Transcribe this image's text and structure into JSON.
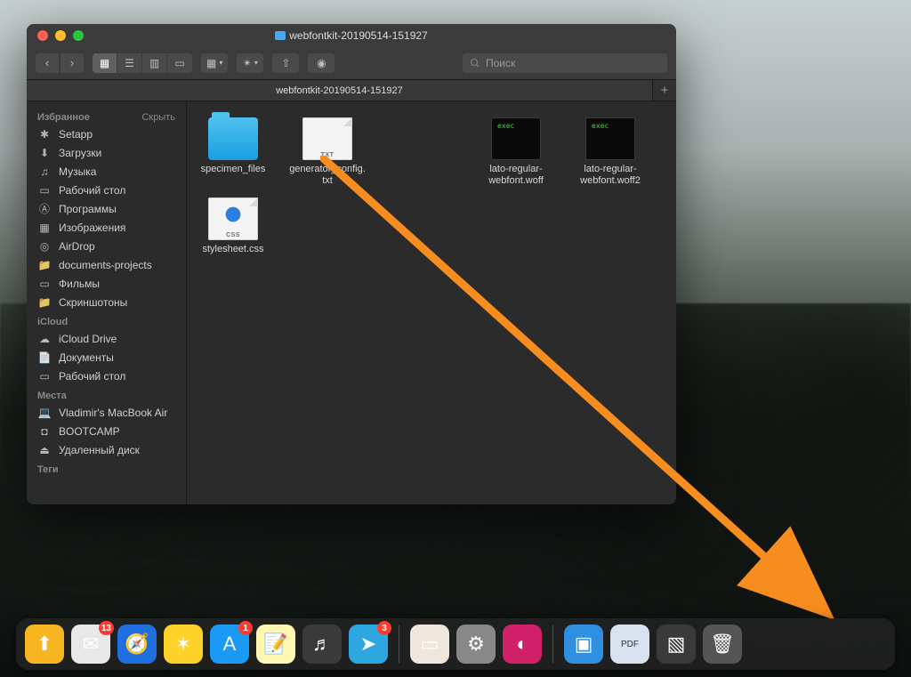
{
  "window": {
    "title": "webfontkit-20190514-151927",
    "tab": "webfontkit-20190514-151927",
    "search_placeholder": "Поиск"
  },
  "sidebar": {
    "sections": [
      {
        "title": "Избранное",
        "hide": "Скрыть",
        "items": [
          {
            "icon": "setapp",
            "label": "Setapp"
          },
          {
            "icon": "downloads",
            "label": "Загрузки"
          },
          {
            "icon": "music",
            "label": "Музыка"
          },
          {
            "icon": "desktop",
            "label": "Рабочий стол"
          },
          {
            "icon": "apps",
            "label": "Программы"
          },
          {
            "icon": "images",
            "label": "Изображения"
          },
          {
            "icon": "airdrop",
            "label": "AirDrop"
          },
          {
            "icon": "folder",
            "label": "documents-projects"
          },
          {
            "icon": "movies",
            "label": "Фильмы"
          },
          {
            "icon": "folder",
            "label": "Скриншотоны"
          }
        ]
      },
      {
        "title": "iCloud",
        "hide": "",
        "items": [
          {
            "icon": "cloud",
            "label": "iCloud Drive"
          },
          {
            "icon": "docs",
            "label": "Документы"
          },
          {
            "icon": "desktop",
            "label": "Рабочий стол"
          }
        ]
      },
      {
        "title": "Места",
        "hide": "",
        "items": [
          {
            "icon": "laptop",
            "label": "Vladimir's MacBook Air"
          },
          {
            "icon": "disk",
            "label": "BOOTCAMP"
          },
          {
            "icon": "eject",
            "label": "Удаленный диск"
          }
        ]
      },
      {
        "title": "Теги",
        "hide": "",
        "items": []
      }
    ]
  },
  "files": [
    {
      "type": "folder",
      "name": "specimen_files"
    },
    {
      "type": "txt",
      "name": "generator_config.txt"
    },
    {
      "type": "spacer"
    },
    {
      "type": "exec",
      "name": "lato-regular-webfont.woff"
    },
    {
      "type": "exec",
      "name": "lato-regular-webfont.woff2"
    },
    {
      "type": "css",
      "name": "stylesheet.css"
    }
  ],
  "file_ext": {
    "txt": "TXT",
    "css": "CSS"
  },
  "dock": [
    {
      "name": "forklift",
      "color": "#f7b521"
    },
    {
      "name": "mail",
      "color": "#e8e8e8",
      "badge": "13"
    },
    {
      "name": "safari",
      "color": "#1f6fe0"
    },
    {
      "name": "butterfly",
      "color": "#ffd229"
    },
    {
      "name": "appstore",
      "color": "#1a9af4",
      "badge": "1"
    },
    {
      "name": "notes",
      "color": "#fff7b2"
    },
    {
      "name": "logic",
      "color": "#3a3a3a"
    },
    {
      "name": "telegram",
      "color": "#2ea6e0",
      "badge": "3"
    },
    {
      "name": "sep"
    },
    {
      "name": "bear",
      "color": "#efe6dc"
    },
    {
      "name": "settings",
      "color": "#888"
    },
    {
      "name": "cleanmymac",
      "color": "#d0206a"
    },
    {
      "name": "sep"
    },
    {
      "name": "dropbox",
      "color": "#2f8fe0"
    },
    {
      "name": "pdf",
      "color": "#d9e3ef"
    },
    {
      "name": "screenshot",
      "color": "#3a3a3a"
    },
    {
      "name": "trash",
      "color": "#555"
    }
  ]
}
